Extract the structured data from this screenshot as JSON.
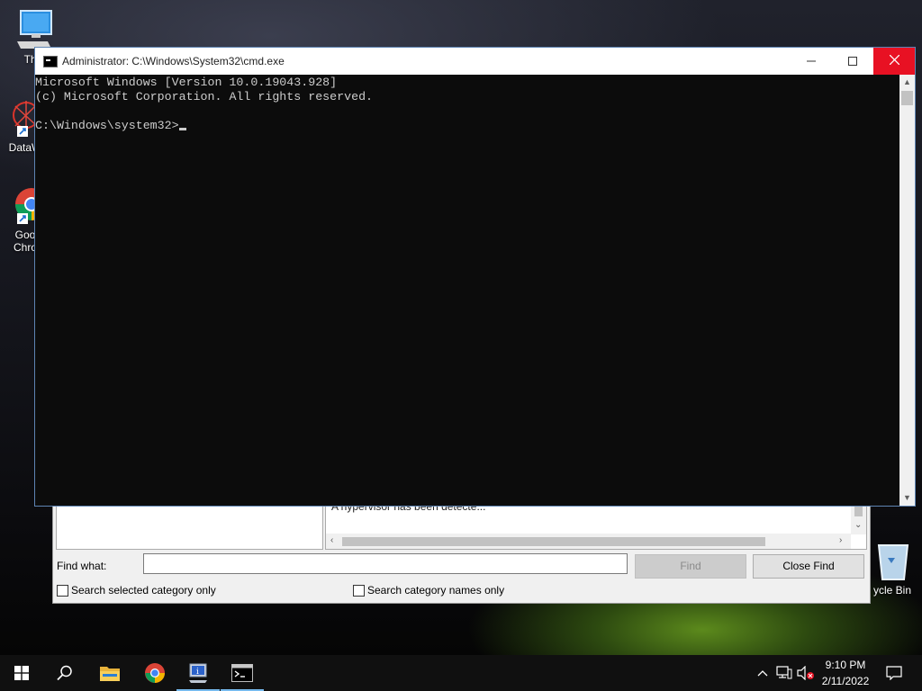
{
  "desktop": {
    "icons": [
      {
        "label_1": "This",
        "label_2": ""
      },
      {
        "label_1": "DataW",
        "label_2": ""
      },
      {
        "label_1": "Goo",
        "label_2": "Chro"
      },
      {
        "label_1": "ycle Bin",
        "label_2": ""
      }
    ]
  },
  "background_window": {
    "right_list_row": "A hypervisor has been detecte...",
    "find_label": "Find what:",
    "find_value": "",
    "find_button": "Find",
    "close_find_button": "Close Find",
    "checkbox_selected": "Search selected category only",
    "checkbox_names": "Search category names only"
  },
  "cmd": {
    "title": "Administrator: C:\\Windows\\System32\\cmd.exe",
    "lines": [
      "Microsoft Windows [Version 10.0.19043.928]",
      "(c) Microsoft Corporation. All rights reserved.",
      "",
      "C:\\Windows\\system32>"
    ]
  },
  "taskbar": {
    "time": "9:10 PM",
    "date": "2/11/2022",
    "items": [
      "start",
      "search",
      "file-explorer",
      "chrome",
      "system-information",
      "command-prompt"
    ]
  }
}
